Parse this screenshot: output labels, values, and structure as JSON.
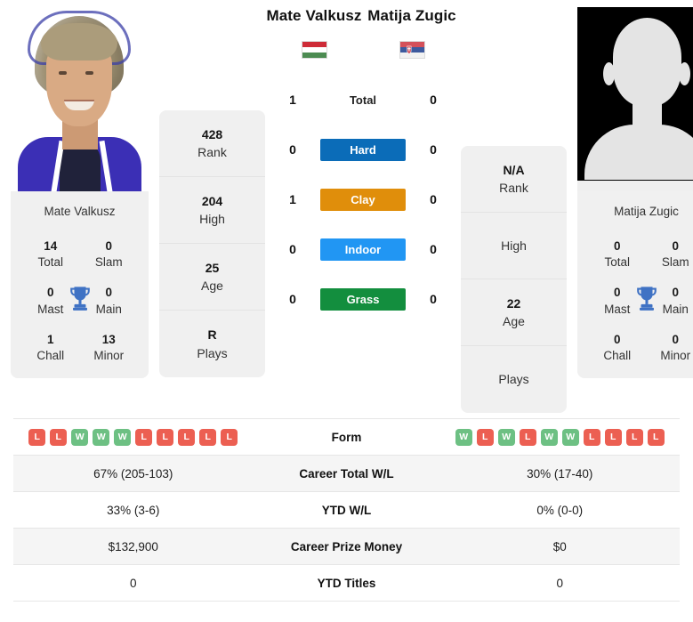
{
  "players": {
    "left": {
      "name": "Mate Valkusz",
      "photo_caption": "Mate Valkusz",
      "flag": "hungary-flag",
      "titles": {
        "total_value": "14",
        "total_label": "Total",
        "slam_value": "0",
        "slam_label": "Slam",
        "mast_value": "0",
        "mast_label": "Mast",
        "main_value": "0",
        "main_label": "Main",
        "chall_value": "1",
        "chall_label": "Chall",
        "minor_value": "13",
        "minor_label": "Minor"
      },
      "info": [
        {
          "value": "428",
          "key": "Rank"
        },
        {
          "value": "204",
          "key": "High"
        },
        {
          "value": "25",
          "key": "Age"
        },
        {
          "value": "R",
          "key": "Plays"
        }
      ],
      "form": [
        "L",
        "L",
        "W",
        "W",
        "W",
        "L",
        "L",
        "L",
        "L",
        "L"
      ],
      "stats": {
        "career_total_wl": "67% (205-103)",
        "ytd_wl": "33% (3-6)",
        "career_prize_money": "$132,900",
        "ytd_titles": "0"
      }
    },
    "right": {
      "name": "Matija Zugic",
      "photo_caption": "Matija Zugic",
      "flag": "serbia-flag",
      "titles": {
        "total_value": "0",
        "total_label": "Total",
        "slam_value": "0",
        "slam_label": "Slam",
        "mast_value": "0",
        "mast_label": "Mast",
        "main_value": "0",
        "main_label": "Main",
        "chall_value": "0",
        "chall_label": "Chall",
        "minor_value": "0",
        "minor_label": "Minor"
      },
      "info": [
        {
          "value": "N/A",
          "key": "Rank"
        },
        {
          "value": "",
          "key": "High"
        },
        {
          "value": "22",
          "key": "Age"
        },
        {
          "value": "",
          "key": "Plays"
        }
      ],
      "form": [
        "W",
        "L",
        "W",
        "L",
        "W",
        "W",
        "L",
        "L",
        "L",
        "L"
      ],
      "stats": {
        "career_total_wl": "30% (17-40)",
        "ytd_wl": "0% (0-0)",
        "career_prize_money": "$0",
        "ytd_titles": "0"
      }
    }
  },
  "head_to_head": [
    {
      "label": "Total",
      "left": "1",
      "right": "0",
      "badge": false,
      "color": ""
    },
    {
      "label": "Hard",
      "left": "0",
      "right": "0",
      "badge": true,
      "color": "#0B6CB8"
    },
    {
      "label": "Clay",
      "left": "1",
      "right": "0",
      "badge": true,
      "color": "#E08E0B"
    },
    {
      "label": "Indoor",
      "left": "0",
      "right": "0",
      "badge": true,
      "color": "#2196F3"
    },
    {
      "label": "Grass",
      "left": "0",
      "right": "0",
      "badge": true,
      "color": "#138E3E"
    }
  ],
  "stats_rows": [
    {
      "label": "Form",
      "key": "form"
    },
    {
      "label": "Career Total W/L",
      "key": "career_total_wl"
    },
    {
      "label": "YTD W/L",
      "key": "ytd_wl"
    },
    {
      "label": "Career Prize Money",
      "key": "career_prize_money"
    },
    {
      "label": "YTD Titles",
      "key": "ytd_titles"
    }
  ],
  "colors": {
    "win_badge": "#6dc083",
    "loss_badge": "#ec5f52",
    "card_bg": "#f0f0f0",
    "row_shade": "#f5f5f5"
  }
}
